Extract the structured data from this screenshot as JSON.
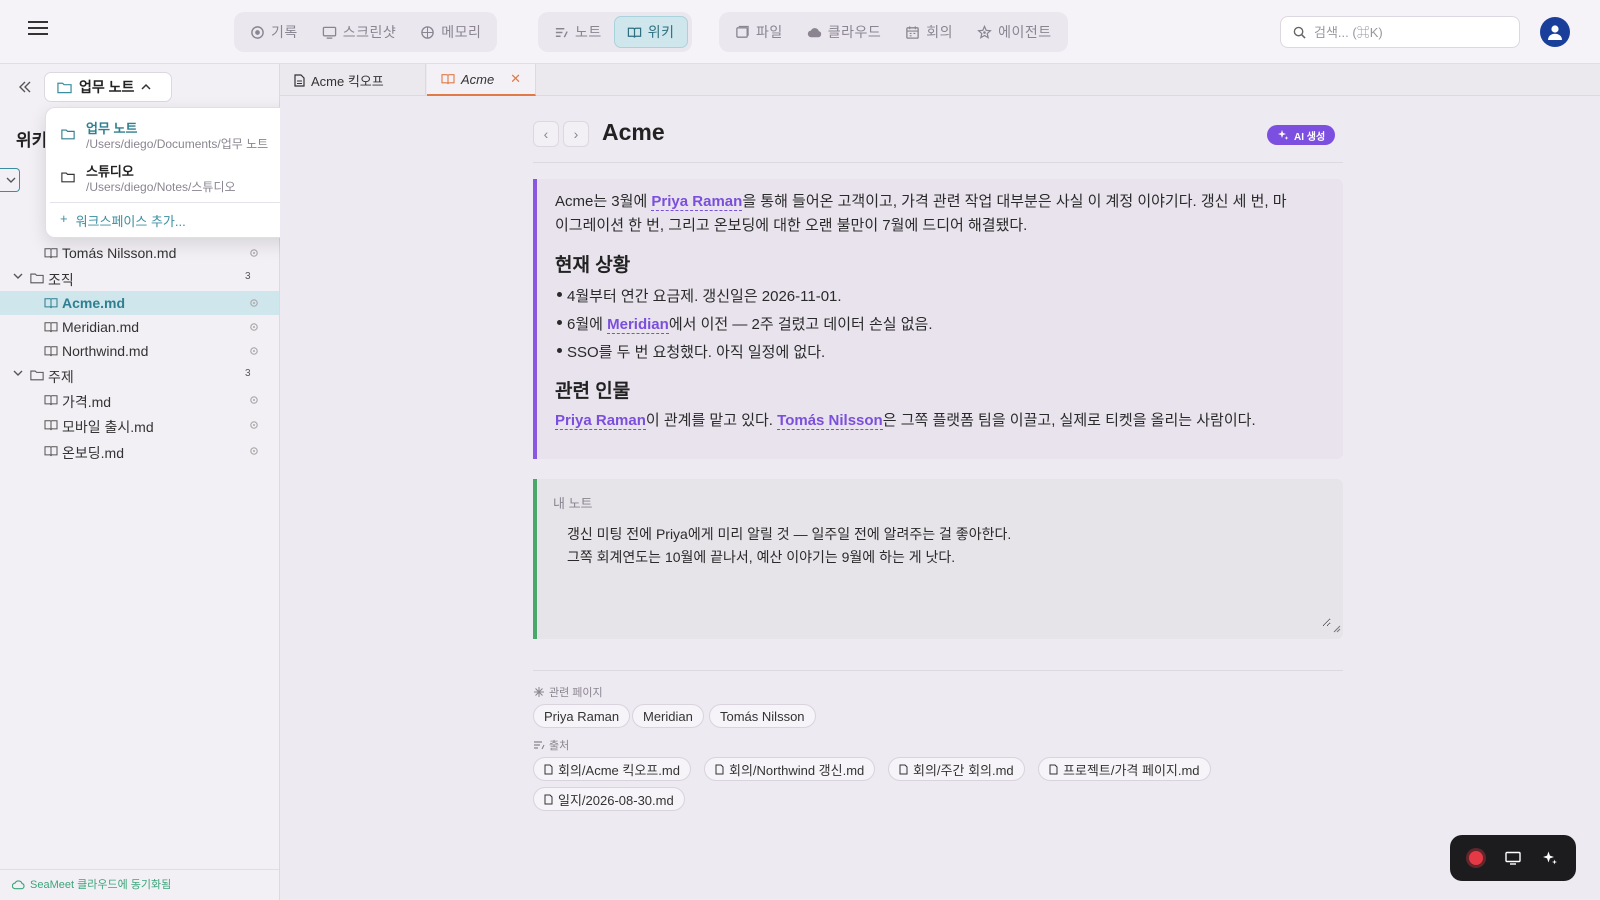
{
  "topnav": {
    "group1": [
      {
        "label": "기록",
        "icon": "record-icon"
      },
      {
        "label": "스크린샷",
        "icon": "screenshot-icon"
      },
      {
        "label": "메모리",
        "icon": "memory-icon"
      }
    ],
    "group2": [
      {
        "label": "노트",
        "icon": "note-icon"
      },
      {
        "label": "위키",
        "icon": "wiki-icon",
        "active": true
      }
    ],
    "group3": [
      {
        "label": "파일",
        "icon": "file-icon"
      },
      {
        "label": "클라우드",
        "icon": "cloud-icon"
      },
      {
        "label": "회의",
        "icon": "calendar-icon"
      },
      {
        "label": "에이전트",
        "icon": "agent-icon"
      }
    ],
    "search_placeholder": "검색... (⌘K)"
  },
  "sidebar": {
    "workspace_label": "업무 노트",
    "title": "위키",
    "tree": [
      {
        "type": "file",
        "label": "Tomás Nilsson.md",
        "indent": 2
      },
      {
        "type": "folder",
        "label": "조직",
        "count": "3"
      },
      {
        "type": "file",
        "label": "Acme.md",
        "indent": 2,
        "selected": true
      },
      {
        "type": "file",
        "label": "Meridian.md",
        "indent": 2
      },
      {
        "type": "file",
        "label": "Northwind.md",
        "indent": 2
      },
      {
        "type": "folder",
        "label": "주제",
        "count": "3"
      },
      {
        "type": "file",
        "label": "가격.md",
        "indent": 2
      },
      {
        "type": "file",
        "label": "모바일 출시.md",
        "indent": 2
      },
      {
        "type": "file",
        "label": "온보딩.md",
        "indent": 2
      }
    ],
    "sync_status": "SeaMeet 클라우드에 동기화됨"
  },
  "workspace_dropdown": {
    "items": [
      {
        "name": "업무 노트",
        "path": "/Users/diego/Documents/업무 노트",
        "active": true
      },
      {
        "name": "스튜디오",
        "path": "/Users/diego/Notes/스튜디오"
      }
    ],
    "add_label": "워크스페이스 추가..."
  },
  "tabs": [
    {
      "label": "Acme 킥오프",
      "icon": "document-icon"
    },
    {
      "label": "Acme",
      "icon": "wiki-icon",
      "active": true,
      "closable": true
    }
  ],
  "page": {
    "title": "Acme",
    "ai_button": "AI 생성",
    "intro": {
      "t1": "Acme는 3월에 ",
      "link1": "Priya Raman",
      "t2": "을 통해 들어온 고객이고, 가격 관련 작업 대부분은 사실 이 계정 이야기다. 갱신 세 번, 마",
      "line2": "이그레이션 한 번, 그리고 온보딩에 대한 오랜 불만이 7월에 드디어 해결됐다."
    },
    "status_heading": "현재 상황",
    "bullets": {
      "b1": "4월부터 연간 요금제. 갱신일은 2026-11-01.",
      "b2_pre": "6월에 ",
      "b2_link": "Meridian",
      "b2_post": "에서 이전 — 2주 걸렸고 데이터 손실 없음.",
      "b3": "SSO를 두 번 요청했다. 아직 일정에 없다."
    },
    "people_heading": "관련 인물",
    "people": {
      "link1": "Priya Raman",
      "t1": "이 관계를 맡고 있다. ",
      "link2": "Tomás Nilsson",
      "t2": "은 그쪽 플랫폼 팀을 이끌고, 실제로 티켓을 올리는 사람이다."
    },
    "my_note_label": "내 노트",
    "my_note_text": "갱신 미팅 전에 Priya에게 미리 알릴 것 — 일주일 전에 알려주는 걸 좋아한다.\n그쪽 회계연도는 10월에 끝나서, 예산 이야기는 9월에 하는 게 낫다.",
    "related_label": "관련 페이지",
    "related_pages": [
      "Priya Raman",
      "Meridian",
      "Tomás Nilsson"
    ],
    "sources_label": "출처",
    "sources": [
      "회의/Acme 킥오프.md",
      "회의/Northwind 갱신.md",
      "회의/주간 회의.md",
      "프로젝트/가격 페이지.md",
      "일지/2026-08-30.md"
    ]
  },
  "colors": {
    "accent_teal": "#2f7f90",
    "link_purple": "#7b4fdc",
    "ai_purple": "#7c4fe0",
    "note_green": "#48a86a",
    "tab_orange": "#e07a46",
    "record_red": "#e53946"
  }
}
